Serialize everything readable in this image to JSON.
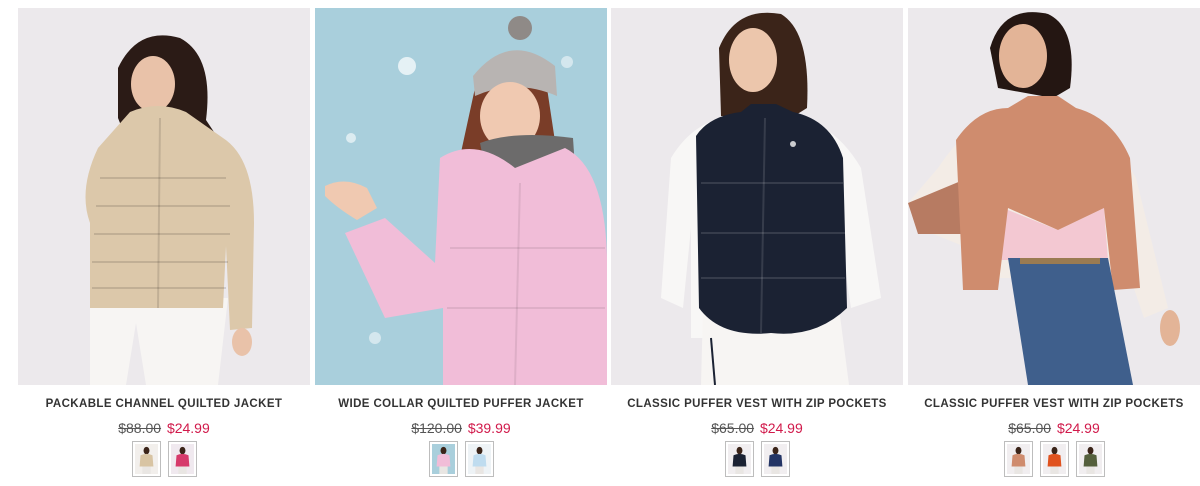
{
  "products": [
    {
      "title": "PACKABLE CHANNEL QUILTED JACKET",
      "old_price": "$88.00",
      "sale_price": "$24.99",
      "photo": {
        "background": "#ece9ec",
        "garment": "#dcc8aa",
        "pants": "#f7f5f3"
      },
      "swatches": [
        {
          "background": "#f2efec",
          "garment": "#d8c4a3"
        },
        {
          "background": "#f0e9ef",
          "garment": "#d63a6b"
        }
      ]
    },
    {
      "title": "WIDE COLLAR QUILTED PUFFER JACKET",
      "old_price": "$120.00",
      "sale_price": "$39.99",
      "photo": {
        "background": "#a9cfdc",
        "garment": "#f1bdd8",
        "pants": "#f4ede6"
      },
      "swatches": [
        {
          "background": "#a9cfdc",
          "garment": "#f1bdd8"
        },
        {
          "background": "#eef3f6",
          "garment": "#bfdcef"
        }
      ]
    },
    {
      "title": "CLASSIC PUFFER VEST WITH ZIP POCKETS",
      "old_price": "$65.00",
      "sale_price": "$24.99",
      "photo": {
        "background": "#ece9ec",
        "garment": "#1b2233",
        "pants": "#f7f5f3"
      },
      "swatches": [
        {
          "background": "#f1eef0",
          "garment": "#1b2233"
        },
        {
          "background": "#f1eef0",
          "garment": "#243565"
        }
      ]
    },
    {
      "title": "CLASSIC PUFFER VEST WITH ZIP POCKETS",
      "old_price": "$65.00",
      "sale_price": "$24.99",
      "photo": {
        "background": "#ece9ec",
        "garment": "#cf8c6e",
        "pants": "#3f5f8c"
      },
      "swatches": [
        {
          "background": "#f1eef0",
          "garment": "#cf8c6e"
        },
        {
          "background": "#f1eef0",
          "garment": "#e0521e"
        },
        {
          "background": "#f1eef0",
          "garment": "#55603d"
        }
      ]
    }
  ]
}
